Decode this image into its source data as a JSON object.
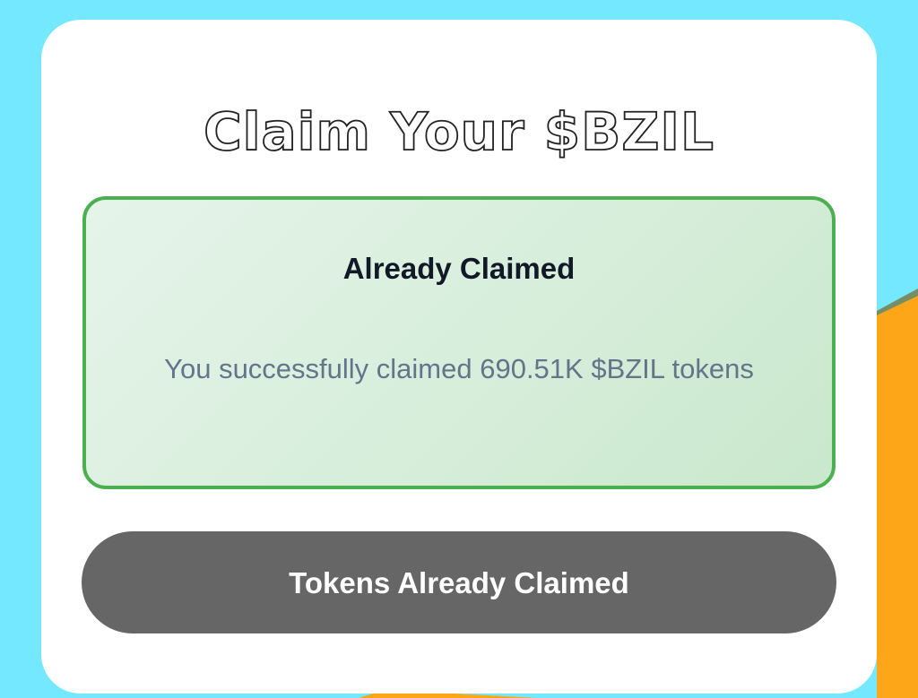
{
  "colors": {
    "background": "#74e8ff",
    "accent_orange": "#fca618",
    "success_border": "#4caf50",
    "button_disabled": "#666666"
  },
  "claim": {
    "title": "Claim Your $BZIL",
    "status_heading": "Already Claimed",
    "status_message": "You successfully claimed 690.51K $BZIL tokens",
    "button_label": "Tokens Already Claimed"
  }
}
